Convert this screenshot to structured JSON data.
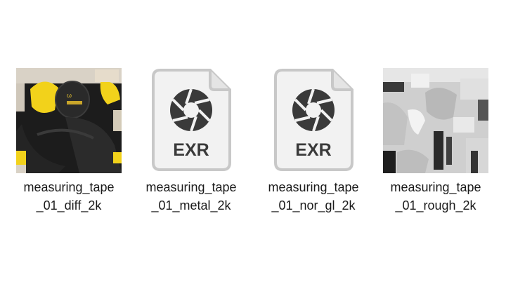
{
  "files": [
    {
      "name_line1": "measuring_tape",
      "name_line2": "_01_diff_2k",
      "type": "image-thumbnail"
    },
    {
      "name_line1": "measuring_tape",
      "name_line2": "_01_metal_2k",
      "type": "exr-file",
      "badge": "EXR"
    },
    {
      "name_line1": "measuring_tape",
      "name_line2": "_01_nor_gl_2k",
      "type": "exr-file",
      "badge": "EXR"
    },
    {
      "name_line1": "measuring_tape",
      "name_line2": "_01_rough_2k",
      "type": "image-thumbnail"
    }
  ],
  "colors": {
    "exr_icon_fill": "#f2f2f2",
    "exr_icon_border": "#c8c8c8",
    "exr_icon_glyph": "#3a3a3a",
    "diff_dark": "#1c1c1c",
    "diff_yellow": "#f2d21b",
    "rough_light": "#d6d6d6"
  }
}
